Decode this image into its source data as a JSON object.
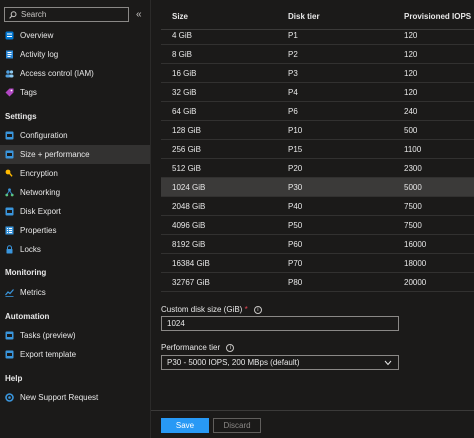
{
  "sidebar": {
    "search_placeholder": "Search",
    "collapse_glyph": "«",
    "items_top": [
      {
        "label": "Overview",
        "icon": "overview-icon",
        "color": "#0078d4"
      },
      {
        "label": "Activity log",
        "icon": "activity-log-icon",
        "color": "#2b88d8"
      },
      {
        "label": "Access control (IAM)",
        "icon": "iam-icon",
        "color": "#50a0e0"
      },
      {
        "label": "Tags",
        "icon": "tag-icon",
        "color": "#b146c2"
      }
    ],
    "settings_header": "Settings",
    "settings_items": [
      {
        "label": "Configuration",
        "icon": "configuration-icon",
        "color": "#3a96dd"
      },
      {
        "label": "Size + performance",
        "icon": "size-performance-icon",
        "color": "#3a96dd"
      },
      {
        "label": "Encryption",
        "icon": "key-icon",
        "color": "#ffb900"
      },
      {
        "label": "Networking",
        "icon": "networking-icon",
        "color": "#3a96dd"
      },
      {
        "label": "Disk Export",
        "icon": "disk-export-icon",
        "color": "#3a96dd"
      },
      {
        "label": "Properties",
        "icon": "properties-icon",
        "color": "#3a96dd"
      },
      {
        "label": "Locks",
        "icon": "lock-icon",
        "color": "#3a96dd"
      }
    ],
    "monitoring_header": "Monitoring",
    "monitoring_items": [
      {
        "label": "Metrics",
        "icon": "metrics-icon",
        "color": "#3a96dd"
      }
    ],
    "automation_header": "Automation",
    "automation_items": [
      {
        "label": "Tasks (preview)",
        "icon": "tasks-icon",
        "color": "#3a96dd"
      },
      {
        "label": "Export template",
        "icon": "export-template-icon",
        "color": "#3a96dd"
      }
    ],
    "help_header": "Help",
    "help_items": [
      {
        "label": "New Support Request",
        "icon": "support-request-icon",
        "color": "#3a96dd"
      }
    ]
  },
  "table": {
    "headers": [
      "Size",
      "Disk tier",
      "Provisioned IOPS"
    ],
    "rows": [
      [
        "4 GiB",
        "P1",
        "120"
      ],
      [
        "8 GiB",
        "P2",
        "120"
      ],
      [
        "16 GiB",
        "P3",
        "120"
      ],
      [
        "32 GiB",
        "P4",
        "120"
      ],
      [
        "64 GiB",
        "P6",
        "240"
      ],
      [
        "128 GiB",
        "P10",
        "500"
      ],
      [
        "256 GiB",
        "P15",
        "1100"
      ],
      [
        "512 GiB",
        "P20",
        "2300"
      ],
      [
        "1024 GiB",
        "P30",
        "5000"
      ],
      [
        "2048 GiB",
        "P40",
        "7500"
      ],
      [
        "4096 GiB",
        "P50",
        "7500"
      ],
      [
        "8192 GiB",
        "P60",
        "16000"
      ],
      [
        "16384 GiB",
        "P70",
        "18000"
      ],
      [
        "32767 GiB",
        "P80",
        "20000"
      ]
    ],
    "selected_row": 8
  },
  "form": {
    "custom_size_label": "Custom disk size (GiB)",
    "required_mark": "*",
    "custom_size_value": "1024",
    "perf_tier_label": "Performance tier",
    "perf_tier_value": "P30 - 5000 IOPS, 200 MBps (default)"
  },
  "footer": {
    "save_label": "Save",
    "discard_label": "Discard"
  },
  "colors": {
    "accent": "#2899f5",
    "required": "#e74856",
    "background": "#1b1a19"
  }
}
